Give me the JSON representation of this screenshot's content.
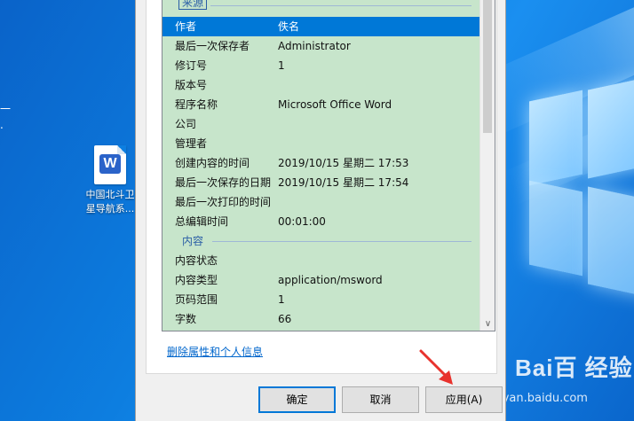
{
  "desktop": {
    "side_text_lines": [
      "一",
      "."
    ],
    "icon": {
      "glyph": "W",
      "name_line1": "中国北斗卫",
      "name_line2": "星导航系..."
    }
  },
  "properties": {
    "group_source": "来源",
    "group_content": "内容",
    "source_rows": [
      {
        "key": "作者",
        "value": "佚名"
      },
      {
        "key": "最后一次保存者",
        "value": "Administrator"
      },
      {
        "key": "修订号",
        "value": "1"
      },
      {
        "key": "版本号",
        "value": ""
      },
      {
        "key": "程序名称",
        "value": "Microsoft Office Word"
      },
      {
        "key": "公司",
        "value": ""
      },
      {
        "key": "管理者",
        "value": ""
      },
      {
        "key": "创建内容的时间",
        "value": "2019/10/15 星期二 17:53"
      },
      {
        "key": "最后一次保存的日期",
        "value": "2019/10/15 星期二 17:54"
      },
      {
        "key": "最后一次打印的时间",
        "value": ""
      },
      {
        "key": "总编辑时间",
        "value": "00:01:00"
      }
    ],
    "content_rows": [
      {
        "key": "内容状态",
        "value": ""
      },
      {
        "key": "内容类型",
        "value": "application/msword"
      },
      {
        "key": "页码范围",
        "value": "1"
      },
      {
        "key": "字数",
        "value": "66"
      }
    ],
    "selected_row": "作者",
    "remove_link": "删除属性和个人信息",
    "scroll_down_glyph": "∨"
  },
  "buttons": {
    "ok": "确定",
    "cancel": "取消",
    "apply": "应用(A)"
  },
  "watermark": {
    "main": "Bai百 经验",
    "url": "jingyan.baidu.com"
  },
  "colors": {
    "list_background": "#c7e5cb",
    "selection": "#0078d7",
    "link": "#0066cc",
    "arrow": "#e8322d"
  }
}
